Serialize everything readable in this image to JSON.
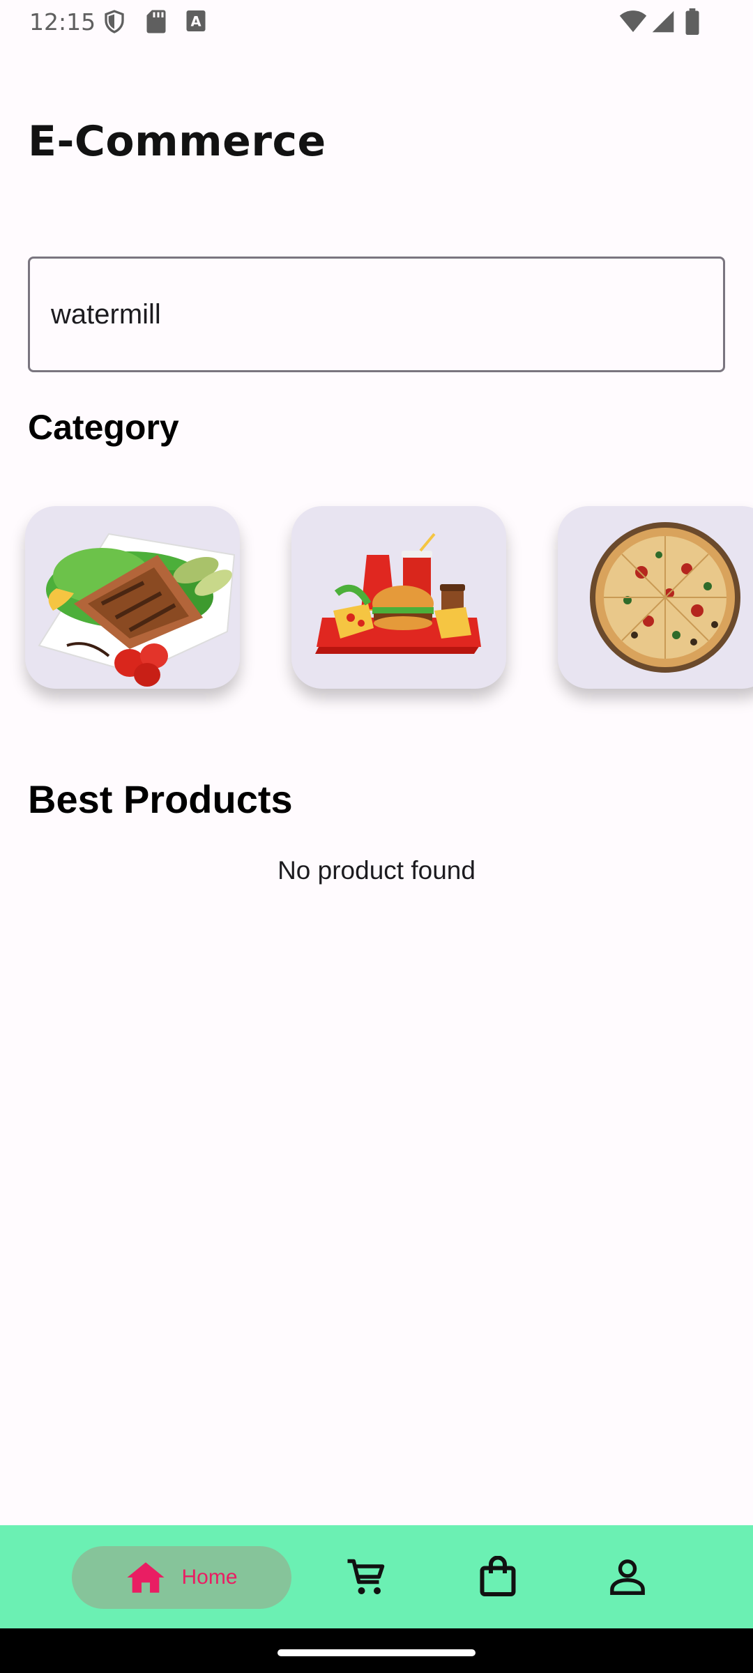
{
  "status_bar": {
    "time": "12:15",
    "icons_left": [
      "shield-icon",
      "sd-card-icon",
      "keyboard-a-icon"
    ],
    "icons_right": [
      "wifi-icon",
      "cell-signal-icon",
      "battery-icon"
    ]
  },
  "header": {
    "title": "E-Commerce"
  },
  "search": {
    "value": "watermill",
    "placeholder": ""
  },
  "categories": {
    "heading": "Category",
    "items": [
      {
        "image": "grilled-salmon-salad-image"
      },
      {
        "image": "fast-food-tray-image"
      },
      {
        "image": "pizza-image"
      }
    ]
  },
  "products": {
    "heading": "Best Products",
    "empty_message": "No product found"
  },
  "bottom_nav": {
    "background": "#6bf0b3",
    "active_pill": "#86c49a",
    "accent": "#e91e63",
    "items": [
      {
        "label": "Home",
        "icon": "home-icon",
        "active": true
      },
      {
        "icon": "cart-icon",
        "active": false
      },
      {
        "icon": "shopping-bag-icon",
        "active": false
      },
      {
        "icon": "person-icon",
        "active": false
      }
    ]
  }
}
